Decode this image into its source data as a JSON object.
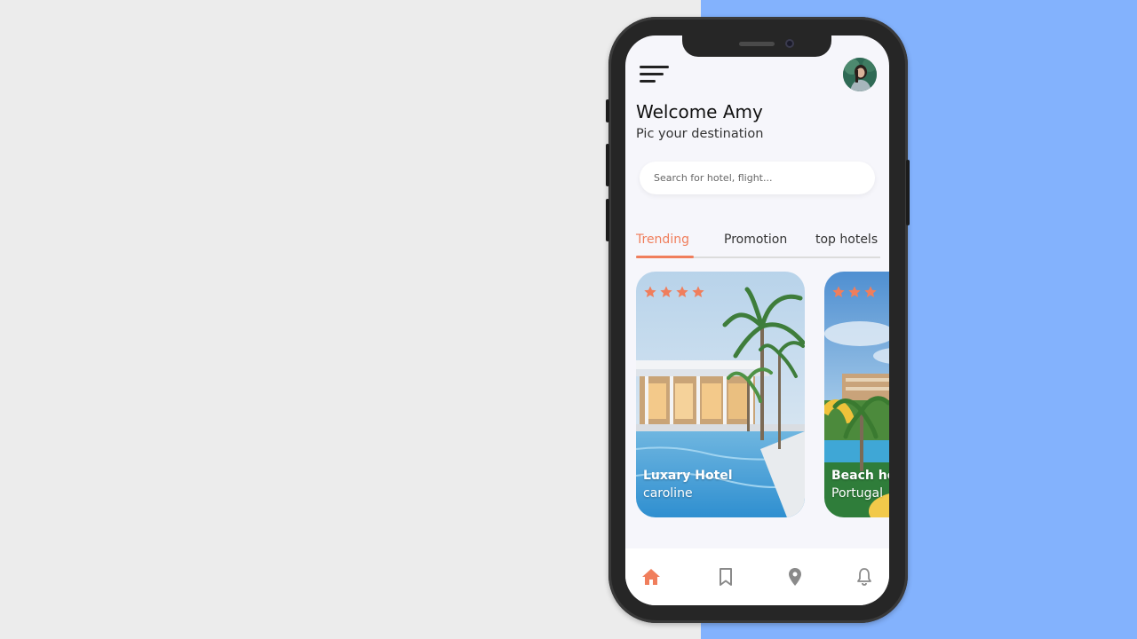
{
  "header": {
    "welcome": "Welcome Amy",
    "subtitle": "Pic your destination"
  },
  "search": {
    "placeholder": "Search for hotel, flight..."
  },
  "tabs": [
    {
      "label": "Trending",
      "active": true
    },
    {
      "label": "Promotion",
      "active": false
    },
    {
      "label": "top hotels",
      "active": false
    }
  ],
  "cards": [
    {
      "title": "Luxary Hotel",
      "subtitle": "caroline",
      "rating": 4
    },
    {
      "title": "Beach hotel",
      "subtitle": "Portugal",
      "rating": 3
    }
  ],
  "bottom_nav": [
    {
      "icon": "home-icon",
      "active": true
    },
    {
      "icon": "bookmark-icon",
      "active": false
    },
    {
      "icon": "location-pin-icon",
      "active": false
    },
    {
      "icon": "bell-icon",
      "active": false
    }
  ],
  "colors": {
    "accent": "#f07e5c",
    "left_background": "#ececec",
    "right_background": "#83b2fd",
    "phone_frame": "#262626",
    "screen_background": "#f6f6fb"
  }
}
